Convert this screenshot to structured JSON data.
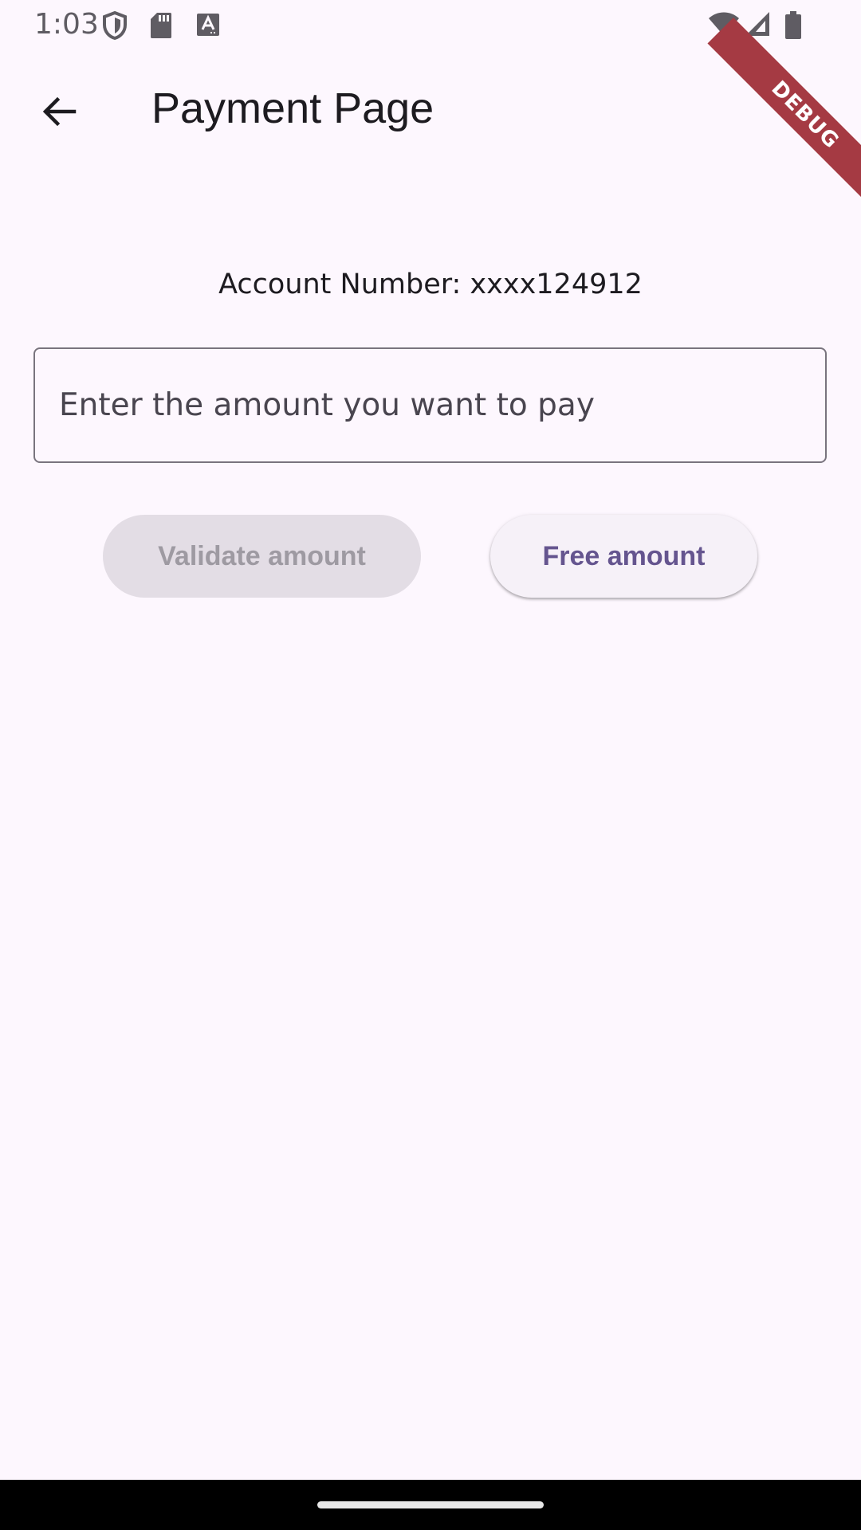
{
  "status_bar": {
    "time": "1:03",
    "icons": [
      "shield-icon",
      "sd-card-icon",
      "keyboard-a-icon",
      "wifi-icon",
      "signal-icon",
      "battery-icon"
    ]
  },
  "debug_banner": {
    "label": "DEBUG"
  },
  "app_bar": {
    "back_icon": "arrow-back-icon",
    "title": "Payment Page"
  },
  "content": {
    "account_number": "Account Number: xxxx124912",
    "amount_input": {
      "placeholder": "Enter the amount you want to pay",
      "value": ""
    },
    "validate_button": {
      "label": "Validate amount",
      "enabled": false
    },
    "free_button": {
      "label": "Free amount",
      "enabled": true
    }
  },
  "colors": {
    "background": "#fdf7fe",
    "primary": "#65558f",
    "disabled_bg": "#e3dde5",
    "disabled_text": "#9e9aa2",
    "outline": "#79747e",
    "debug_ribbon": "#a53a43"
  }
}
